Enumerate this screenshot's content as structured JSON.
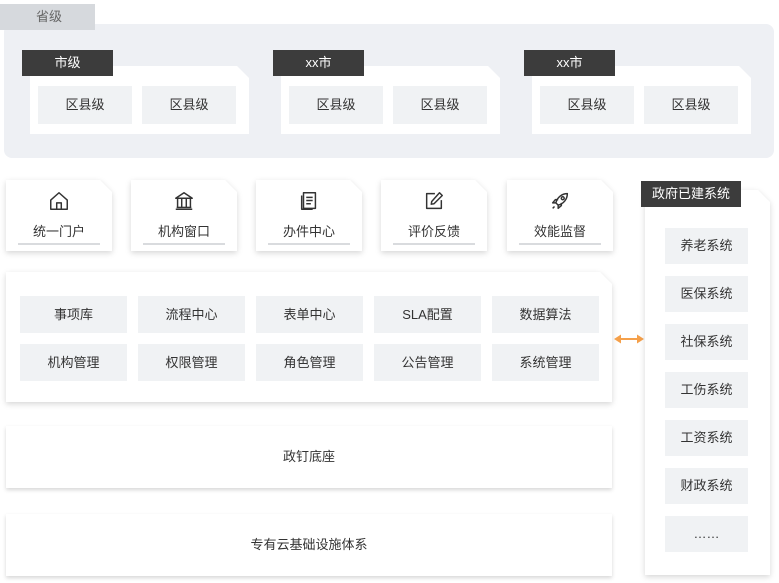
{
  "province": {
    "label": "省级",
    "cities": [
      {
        "label": "市级",
        "counties": [
          "区县级",
          "区县级"
        ]
      },
      {
        "label": "xx市",
        "counties": [
          "区县级",
          "区县级"
        ]
      },
      {
        "label": "xx市",
        "counties": [
          "区县级",
          "区县级"
        ]
      }
    ]
  },
  "portals": [
    {
      "label": "统一门户",
      "icon": "home-icon"
    },
    {
      "label": "机构窗口",
      "icon": "bank-icon"
    },
    {
      "label": "办件中心",
      "icon": "document-icon"
    },
    {
      "label": "评价反馈",
      "icon": "edit-icon"
    },
    {
      "label": "效能监督",
      "icon": "rocket-icon"
    }
  ],
  "capabilities": [
    [
      "事项库",
      "流程中心",
      "表单中心",
      "SLA配置",
      "数据算法"
    ],
    [
      "机构管理",
      "权限管理",
      "角色管理",
      "公告管理",
      "系统管理"
    ]
  ],
  "layers": [
    "政钉底座",
    "专有云基础设施体系"
  ],
  "existing_systems": {
    "title": "政府已建系统",
    "items": [
      "养老系统",
      "医保系统",
      "社保系统",
      "工伤系统",
      "工资系统",
      "财政系统",
      "……"
    ]
  },
  "colors": {
    "dark_tab": "#3c3c3c",
    "panel_bg": "#eef0f4",
    "item_bg": "#f0f2f4",
    "connector": "#f5a04a"
  }
}
